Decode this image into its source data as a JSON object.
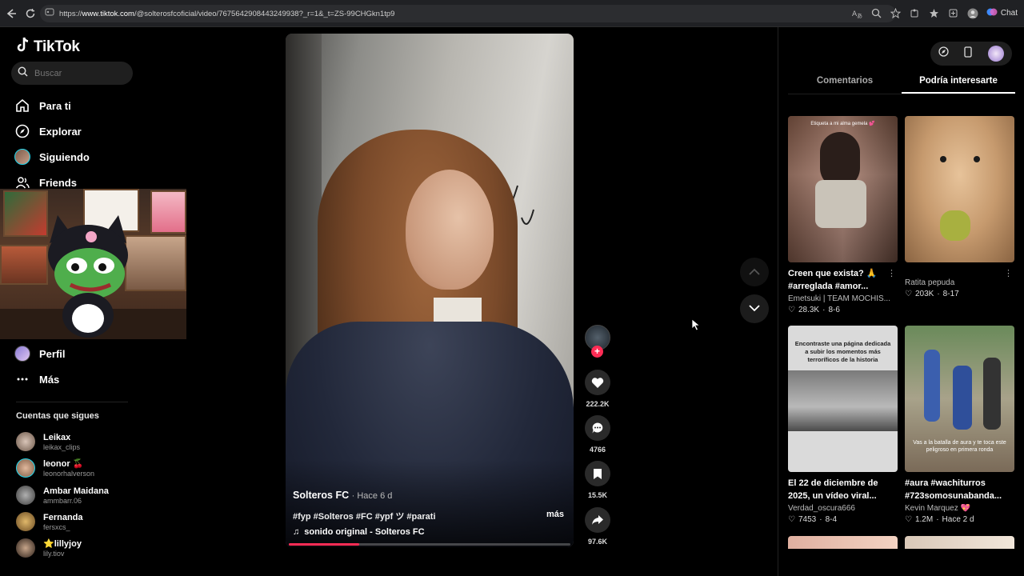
{
  "browser": {
    "url_prefix": "https://",
    "url_host": "www.tiktok.com",
    "url_path": "/@solterosfcoficial/video/7675642908443249938?_r=1&_t=ZS-99CHGkn1tp9",
    "chat_label": "Chat"
  },
  "sidebar": {
    "logo": "TikTok",
    "search_placeholder": "Buscar",
    "nav": [
      {
        "label": "Para ti",
        "icon": "home-icon"
      },
      {
        "label": "Explorar",
        "icon": "compass-icon"
      },
      {
        "label": "Siguiendo",
        "icon": "avatar"
      },
      {
        "label": "Friends",
        "icon": "friends-icon"
      },
      {
        "label": "Perfil",
        "icon": "avatar"
      },
      {
        "label": "Más",
        "icon": "more-icon"
      }
    ],
    "following_title": "Cuentas que sigues",
    "following": [
      {
        "name": "Leikax",
        "handle": "leikax_clips"
      },
      {
        "name": "leonor 🍒",
        "handle": "leonorhalverson"
      },
      {
        "name": "Ambar Maidana",
        "handle": "ammbarr.06"
      },
      {
        "name": "Fernanda",
        "handle": "fersxcs_"
      },
      {
        "name": "⭐lillyjoy",
        "handle": "lily.tiov"
      }
    ]
  },
  "video": {
    "author": "Solteros FC",
    "posted": "· Hace 6 d",
    "tags": "#fyp #Solteros #FC #ypf ツ #parati",
    "more": "más",
    "sound": "sonido original - Solteros FC",
    "progress": 0.25
  },
  "actions": {
    "likes": "222.2K",
    "comments": "4766",
    "saves": "15.5K",
    "shares": "97.6K"
  },
  "right_panel": {
    "tabs": [
      "Comentarios",
      "Podría interesarte"
    ],
    "active_tab": "Podría interesarte",
    "cards": [
      {
        "title": "Creen que exista? 🙏 #arreglada #amor...",
        "user": "Emetsuki | TEAM MOCHIS...",
        "likes": "28.3K",
        "date": "8-6",
        "thumb_text": "Etiqueta a mi alma gemela 💕"
      },
      {
        "title": "",
        "user": "Ratita pepuda",
        "likes": "203K",
        "date": "8-17",
        "thumb_text": ""
      },
      {
        "title": "El 22 de diciembre de 2025, un vídeo viral...",
        "user": "Verdad_oscura666",
        "likes": "7453",
        "date": "8-4",
        "thumb_text": "Encontraste una página dedicada a subir los momentos más terroríficos de la historia"
      },
      {
        "title": "#aura #wachiturros #723somosunabanda...",
        "user": "Kevin Marquez 💖",
        "likes": "1.2M",
        "date": "Hace 2 d",
        "thumb_text": "Vas a la batalla de aura y te toca este peligroso en primera ronda"
      }
    ]
  },
  "colors": {
    "accent": "#fe2c55",
    "cyan": "#20d5ec",
    "bg": "#000000"
  }
}
